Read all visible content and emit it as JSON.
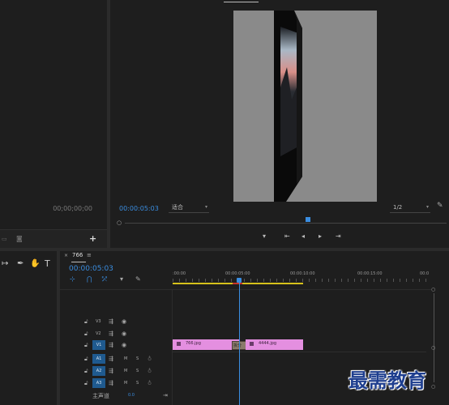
{
  "source_monitor": {
    "timecode": "00;00;00;00"
  },
  "program_monitor": {
    "timecode": "00:00:05:03",
    "fit": "适合",
    "resolution": "1/2"
  },
  "timeline": {
    "tab_name": "766",
    "tab_menu": "≡",
    "timecode": "00:00:05:03",
    "ruler": [
      ":00:00",
      "00:00:05:00",
      "00:00:10:00",
      "00:00:15:00",
      "00:0"
    ],
    "tracks": [
      {
        "name": "V3",
        "target": false
      },
      {
        "name": "V2",
        "target": false
      },
      {
        "name": "V1",
        "target": true
      },
      {
        "name": "A1",
        "target": true
      },
      {
        "name": "A2",
        "target": true
      },
      {
        "name": "A3",
        "target": true
      }
    ],
    "audio_buttons": {
      "mute": "M",
      "solo": "S"
    },
    "master": {
      "label": "主声道",
      "value": "0.0"
    },
    "clips": [
      {
        "name": "766.jpg"
      },
      {
        "name": "4444.jpg"
      }
    ],
    "transition_label": "拆分"
  },
  "watermark": "最需教育",
  "colors": {
    "accent": "#3a8de0",
    "clip": "#e48fe0",
    "work_area": "#d6c21b",
    "playhead": "#3a8de0"
  }
}
